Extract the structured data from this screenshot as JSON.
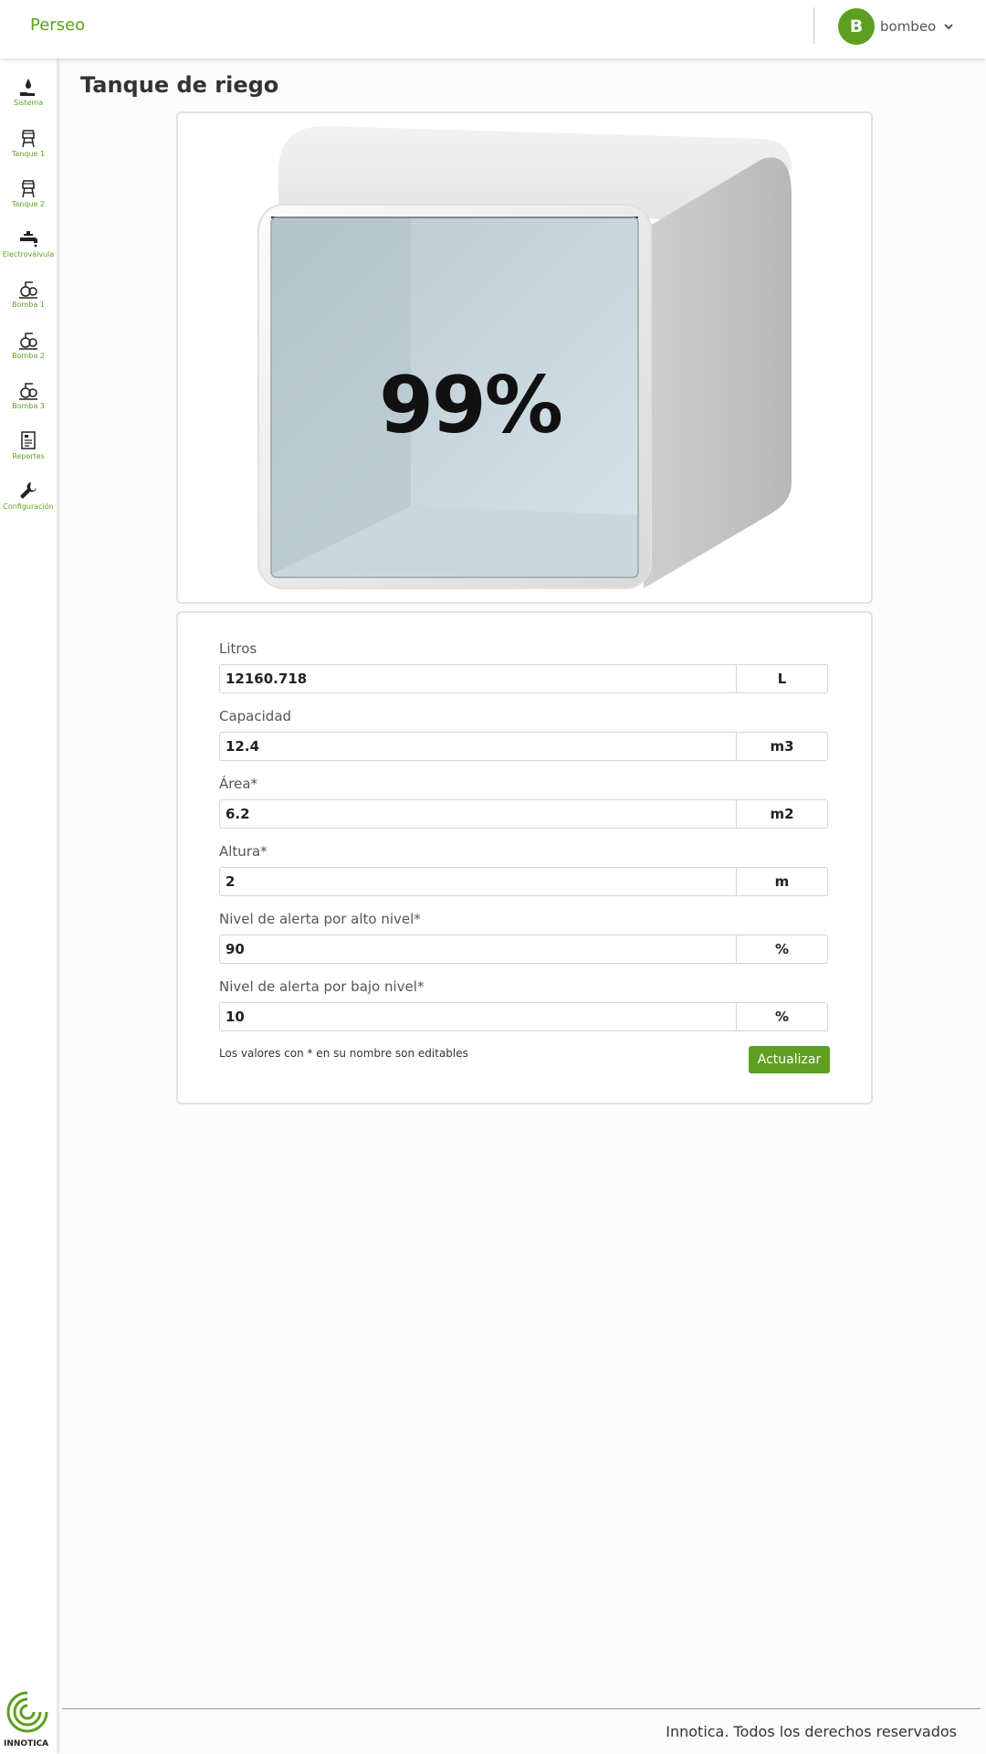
{
  "header": {
    "brand": "Perseo",
    "user_initial": "B",
    "user_name": "bombeo"
  },
  "sidebar": {
    "items": [
      {
        "label": "Sistema",
        "icon": "hand-water-icon"
      },
      {
        "label": "Tanque 1",
        "icon": "water-tower-icon"
      },
      {
        "label": "Tanque 2",
        "icon": "water-tower-icon"
      },
      {
        "label": "Electroválvula",
        "icon": "faucet-icon"
      },
      {
        "label": "Bomba 1",
        "icon": "pump-icon"
      },
      {
        "label": "Bomba 2",
        "icon": "pump-icon"
      },
      {
        "label": "Bomba 3",
        "icon": "pump-icon"
      },
      {
        "label": "Reportes",
        "icon": "report-icon"
      },
      {
        "label": "Configuración",
        "icon": "wrench-icon"
      }
    ],
    "logo_text": "INNOTICA"
  },
  "main": {
    "title": "Tanque de riego",
    "tank": {
      "level_text": "99%",
      "level_fraction": 0.99
    },
    "fields": [
      {
        "label": "Litros",
        "value": "12160.718",
        "unit": "L"
      },
      {
        "label": "Capacidad",
        "value": "12.4",
        "unit": "m3"
      },
      {
        "label": "Área*",
        "value": "6.2",
        "unit": "m2"
      },
      {
        "label": "Altura*",
        "value": "2",
        "unit": "m"
      },
      {
        "label": "Nivel de alerta por alto nivel*",
        "value": "90",
        "unit": "%"
      },
      {
        "label": "Nivel de alerta por bajo nivel*",
        "value": "10",
        "unit": "%"
      }
    ],
    "note": "Los valores con * en su nombre son editables",
    "update_button": "Actualizar"
  },
  "footer": {
    "text": "Innotica. Todos los derechos reservados"
  },
  "colors": {
    "accent": "#5e9f1f"
  }
}
